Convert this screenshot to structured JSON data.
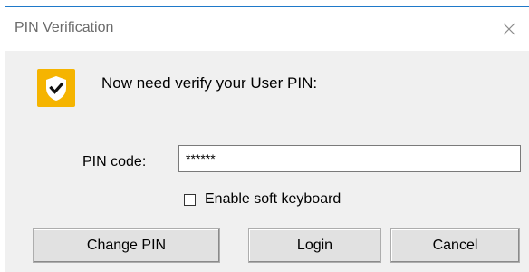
{
  "dialog": {
    "title": "PIN Verification",
    "prompt": "Now need verify your User PIN:",
    "icon": "shield-check-icon",
    "accent_color": "#f5b400"
  },
  "pin": {
    "label": "PIN code:",
    "value": "******"
  },
  "soft_keyboard": {
    "label": "Enable soft keyboard",
    "checked": false
  },
  "buttons": {
    "change_pin": "Change PIN",
    "login": "Login",
    "cancel": "Cancel"
  }
}
